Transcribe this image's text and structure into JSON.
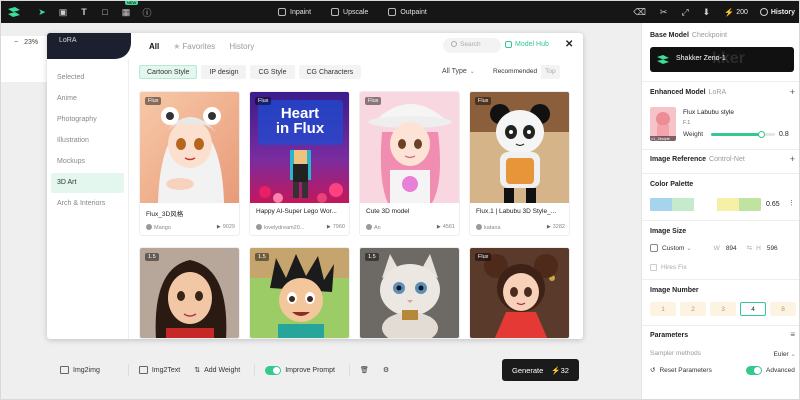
{
  "topbar": {
    "tools": [
      {
        "label": "Inpaint",
        "icon": "inpaint-icon"
      },
      {
        "label": "Upscale",
        "icon": "upscale-icon"
      },
      {
        "label": "Outpaint",
        "icon": "outpaint-icon"
      }
    ],
    "new_badge": "NEW",
    "credits": "200",
    "history_label": "History"
  },
  "canvas": {
    "zoom_label": "23%"
  },
  "dialog": {
    "lora_tab": "LoRA",
    "tabs": [
      "All",
      "Favorites",
      "History"
    ],
    "search_placeholder": "Search",
    "model_hub_label": "Model Hub",
    "sidebar": [
      "Selected",
      "Anime",
      "Photography",
      "Illustration",
      "Mockups",
      "3D Art",
      "Arch & Interiors"
    ],
    "active_category": "3D Art",
    "filters": [
      "Cartoon Style",
      "IP design",
      "CG Style",
      "CG Characters"
    ],
    "active_filter": "Cartoon Style",
    "type_select": "All Type",
    "sort_options": [
      "Recommended",
      "Top"
    ],
    "cards": [
      {
        "tag": "Flux",
        "name": "Flux_3D风格",
        "author": "Mango",
        "uses": "9029"
      },
      {
        "tag": "Flux",
        "name": "Happy AI-Super Lego Wor...",
        "author": "lovelydream20...",
        "uses": "7960",
        "thumb_title": "Heart\nin Flux"
      },
      {
        "tag": "Flux",
        "name": "Cute 3D model",
        "author": "An",
        "uses": "4561"
      },
      {
        "tag": "Flux",
        "name": "Flux.1 | Labubu 3D Style_...",
        "author": "katana",
        "uses": "3282"
      },
      {
        "tag": "1.5"
      },
      {
        "tag": "1.5"
      },
      {
        "tag": "1.5"
      },
      {
        "tag": "Flux"
      }
    ]
  },
  "bottombar": {
    "img2img": "Img2img",
    "img2text": "Img2Text",
    "add_weight": "Add Weight",
    "improve_prompt": "Improve Prompt",
    "improve_prompt_on": true,
    "generate_label": "Generate",
    "generate_cost": "32"
  },
  "panel": {
    "base_model_title": "Base Model",
    "base_model_sub": "Checkpoint",
    "base_model_name": "Shakker Zeno-1",
    "base_model_ghost": "kker",
    "enhanced_title": "Enhanced Model",
    "enhanced_sub": "LoRA",
    "lora_name": "Flux Labubu style",
    "lora_version": "F.1",
    "lora_thumb_label": "v1_2kstyle",
    "weight_label": "Weight",
    "weight_value": "0.8",
    "weight_fraction": 0.8,
    "image_ref_title": "Image Reference",
    "image_ref_sub": "Control-Net",
    "palette_title": "Color Palette",
    "palette_colors": [
      "#a5d4ec",
      "#c6eacc",
      "#ffffff",
      "#f6f0a6",
      "#c0e3a2"
    ],
    "palette_value": "0.65",
    "image_size_title": "Image Size",
    "size_preset": "Custom",
    "w_label": "W",
    "width": "894",
    "h_label": "H",
    "height": "596",
    "hires_label": "Hires Fix",
    "image_number_title": "Image Number",
    "numbers": [
      "1",
      "2",
      "3",
      "4",
      "8"
    ],
    "active_number": "4",
    "parameters_title": "Parameters",
    "sampler_label": "Sampler methods",
    "sampler_value": "Euler",
    "reset_label": "Reset Parameters",
    "advanced_label": "Advanced",
    "advanced_on": true
  }
}
